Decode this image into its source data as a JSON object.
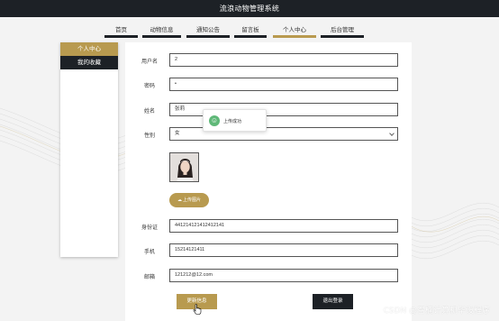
{
  "site_title": "流浪动物管理系统",
  "nav": {
    "tabs": [
      {
        "label": "首页",
        "active": false
      },
      {
        "label": "动物信息",
        "active": false
      },
      {
        "label": "通知公告",
        "active": false
      },
      {
        "label": "留言板",
        "active": false
      },
      {
        "label": "个人中心",
        "active": true
      },
      {
        "label": "后台管理",
        "active": false
      }
    ]
  },
  "sidebar": {
    "items": [
      {
        "label": "个人中心",
        "active": true
      },
      {
        "label": "我的收藏",
        "active": false
      }
    ]
  },
  "form": {
    "username": {
      "label": "用户名",
      "value": "2"
    },
    "password": {
      "label": "密码",
      "value": "•"
    },
    "name": {
      "label": "姓名",
      "value": "张莉"
    },
    "gender": {
      "label": "性别",
      "value": "女"
    },
    "upload_label": "上传图片",
    "id_card": {
      "label": "身份证",
      "value": "441214121412412141"
    },
    "phone": {
      "label": "手机",
      "value": "15214121411"
    },
    "email": {
      "label": "邮箱",
      "value": "121212@12.com"
    }
  },
  "toast": {
    "text": "上传成功",
    "icon": "smile-icon"
  },
  "buttons": {
    "update_label": "更新信息",
    "logout_label": "退出登录"
  },
  "watermark": "CSDN @召楠计算机毕设程序",
  "colors": {
    "dark": "#1d2126",
    "accent": "#b89a4f",
    "success": "#5fb878"
  }
}
